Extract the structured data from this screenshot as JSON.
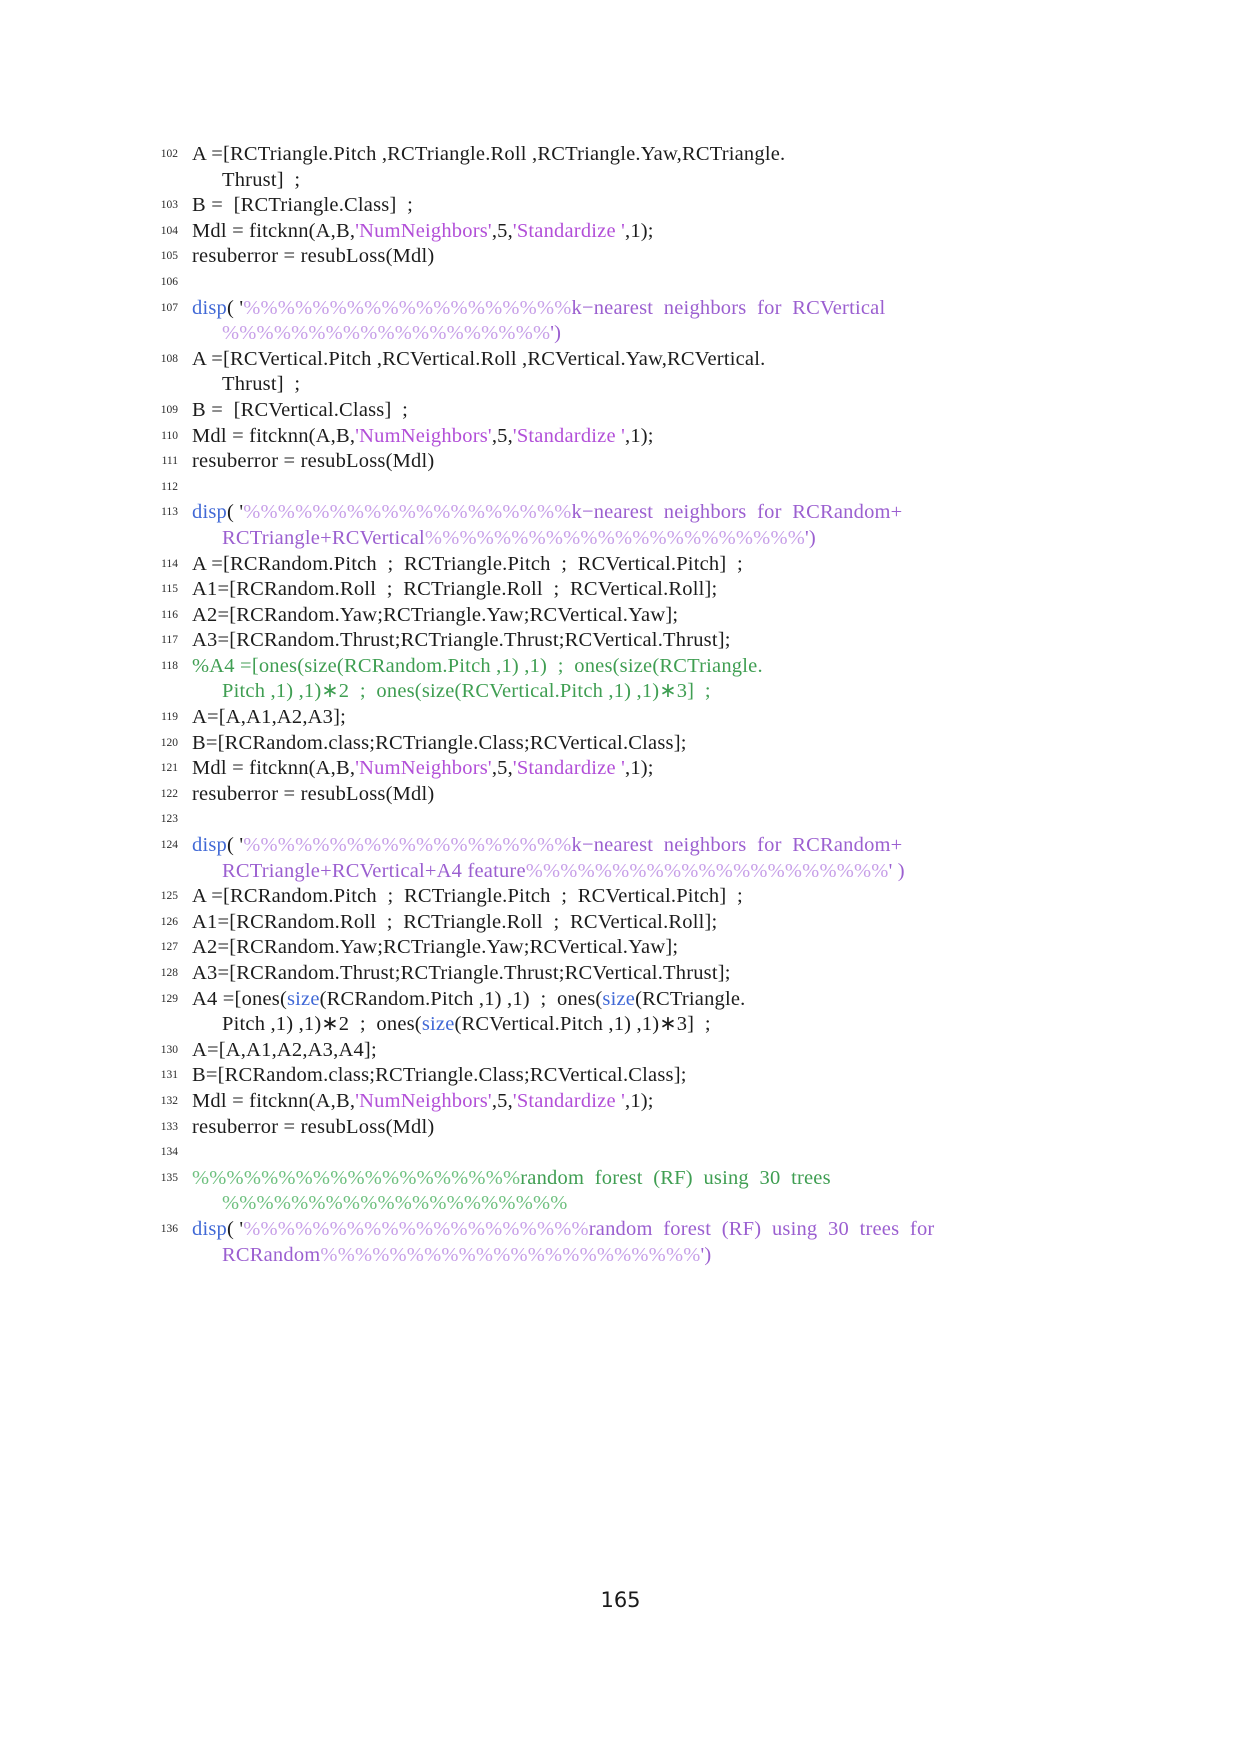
{
  "document": {
    "page_number": "165",
    "type": "code-listing",
    "language": "MATLAB"
  },
  "colors": {
    "plain": "#1c1c1c",
    "keyword": "#4169d6",
    "string": "#b24fd8",
    "string_text": "#9b5fd0",
    "percent_run": "#c79fe8",
    "comment": "#3f9e52",
    "comment_percent_run": "#6ec07f",
    "line_number": "#2b2b2b",
    "background": "#ffffff"
  },
  "listing": {
    "lines": [
      {
        "no": "102",
        "segments": [
          {
            "t": "A =[RCTriangle.Pitch ,RCTriangle.Roll ,RCTriangle.Yaw,RCTriangle.",
            "c": "plain"
          }
        ],
        "cont": [
          {
            "segments": [
              {
                "t": "Thrust]  ;",
                "c": "plain"
              }
            ]
          }
        ]
      },
      {
        "no": "103",
        "segments": [
          {
            "t": "B =  [RCTriangle.Class]  ;",
            "c": "plain"
          }
        ]
      },
      {
        "no": "104",
        "segments": [
          {
            "t": "Mdl = fitcknn(A,B,",
            "c": "plain"
          },
          {
            "t": "'NumNeighbors'",
            "c": "string"
          },
          {
            "t": ",5,",
            "c": "plain"
          },
          {
            "t": "'Standardize '",
            "c": "string"
          },
          {
            "t": ",1);",
            "c": "plain"
          }
        ]
      },
      {
        "no": "105",
        "segments": [
          {
            "t": "resuberror = resubLoss(Mdl)",
            "c": "plain"
          }
        ]
      },
      {
        "no": "106",
        "segments": []
      },
      {
        "no": "107",
        "segments": [
          {
            "t": "disp",
            "c": "keyword"
          },
          {
            "t": "( '",
            "c": "plain"
          },
          {
            "t": "%%%%%%%%%%%%%%%%%%%",
            "c": "percent_run"
          },
          {
            "t": "k−nearest  neighbors  for  RCVertical",
            "c": "string_text"
          }
        ],
        "cont": [
          {
            "segments": [
              {
                "t": "%%%%%%%%%%%%%%%%%%%",
                "c": "percent_run"
              },
              {
                "t": "')",
                "c": "string_text"
              }
            ]
          }
        ]
      },
      {
        "no": "108",
        "segments": [
          {
            "t": "A =[RCVertical.Pitch ,RCVertical.Roll ,RCVertical.Yaw,RCVertical.",
            "c": "plain"
          }
        ],
        "cont": [
          {
            "segments": [
              {
                "t": "Thrust]  ;",
                "c": "plain"
              }
            ]
          }
        ]
      },
      {
        "no": "109",
        "segments": [
          {
            "t": "B =  [RCVertical.Class]  ;",
            "c": "plain"
          }
        ]
      },
      {
        "no": "110",
        "segments": [
          {
            "t": "Mdl = fitcknn(A,B,",
            "c": "plain"
          },
          {
            "t": "'NumNeighbors'",
            "c": "string"
          },
          {
            "t": ",5,",
            "c": "plain"
          },
          {
            "t": "'Standardize '",
            "c": "string"
          },
          {
            "t": ",1);",
            "c": "plain"
          }
        ]
      },
      {
        "no": "111",
        "segments": [
          {
            "t": "resuberror = resubLoss(Mdl)",
            "c": "plain"
          }
        ]
      },
      {
        "no": "112",
        "segments": []
      },
      {
        "no": "113",
        "segments": [
          {
            "t": "disp",
            "c": "keyword"
          },
          {
            "t": "( '",
            "c": "plain"
          },
          {
            "t": "%%%%%%%%%%%%%%%%%%%",
            "c": "percent_run"
          },
          {
            "t": "k−nearest  neighbors  for  RCRandom+",
            "c": "string_text"
          }
        ],
        "cont": [
          {
            "segments": [
              {
                "t": "RCTriangle+RCVertical",
                "c": "string_text"
              },
              {
                "t": "%%%%%%%%%%%%%%%%%%%%%%",
                "c": "percent_run"
              },
              {
                "t": "')",
                "c": "string_text"
              }
            ]
          }
        ]
      },
      {
        "no": "114",
        "segments": [
          {
            "t": "A =[RCRandom.Pitch  ;  RCTriangle.Pitch  ;  RCVertical.Pitch]  ;",
            "c": "plain"
          }
        ]
      },
      {
        "no": "115",
        "segments": [
          {
            "t": "A1=[RCRandom.Roll  ;  RCTriangle.Roll  ;  RCVertical.Roll];",
            "c": "plain"
          }
        ]
      },
      {
        "no": "116",
        "segments": [
          {
            "t": "A2=[RCRandom.Yaw;RCTriangle.Yaw;RCVertical.Yaw];",
            "c": "plain"
          }
        ]
      },
      {
        "no": "117",
        "segments": [
          {
            "t": "A3=[RCRandom.Thrust;RCTriangle.Thrust;RCVertical.Thrust];",
            "c": "plain"
          }
        ]
      },
      {
        "no": "118",
        "segments": [
          {
            "t": "%A4 =[ones(size(RCRandom.Pitch ,1) ,1)  ;  ones(size(RCTriangle.",
            "c": "comment"
          }
        ],
        "cont": [
          {
            "segments": [
              {
                "t": "Pitch ,1) ,1)∗2  ;  ones(size(RCVertical.Pitch ,1) ,1)∗3]  ;",
                "c": "comment"
              }
            ]
          }
        ]
      },
      {
        "no": "119",
        "segments": [
          {
            "t": "A=[A,A1,A2,A3];",
            "c": "plain"
          }
        ]
      },
      {
        "no": "120",
        "segments": [
          {
            "t": "B=[RCRandom.class;RCTriangle.Class;RCVertical.Class];",
            "c": "plain"
          }
        ]
      },
      {
        "no": "121",
        "segments": [
          {
            "t": "Mdl = fitcknn(A,B,",
            "c": "plain"
          },
          {
            "t": "'NumNeighbors'",
            "c": "string"
          },
          {
            "t": ",5,",
            "c": "plain"
          },
          {
            "t": "'Standardize '",
            "c": "string"
          },
          {
            "t": ",1);",
            "c": "plain"
          }
        ]
      },
      {
        "no": "122",
        "segments": [
          {
            "t": "resuberror = resubLoss(Mdl)",
            "c": "plain"
          }
        ]
      },
      {
        "no": "123",
        "segments": []
      },
      {
        "no": "124",
        "segments": [
          {
            "t": "disp",
            "c": "keyword"
          },
          {
            "t": "( '",
            "c": "plain"
          },
          {
            "t": "%%%%%%%%%%%%%%%%%%%",
            "c": "percent_run"
          },
          {
            "t": "k−nearest  neighbors  for  RCRandom+",
            "c": "string_text"
          }
        ],
        "cont": [
          {
            "segments": [
              {
                "t": "RCTriangle+RCVertical+A4 feature",
                "c": "string_text"
              },
              {
                "t": "%%%%%%%%%%%%%%%%%%%%%",
                "c": "percent_run"
              },
              {
                "t": "' )",
                "c": "string_text"
              }
            ]
          }
        ]
      },
      {
        "no": "125",
        "segments": [
          {
            "t": "A =[RCRandom.Pitch  ;  RCTriangle.Pitch  ;  RCVertical.Pitch]  ;",
            "c": "plain"
          }
        ]
      },
      {
        "no": "126",
        "segments": [
          {
            "t": "A1=[RCRandom.Roll  ;  RCTriangle.Roll  ;  RCVertical.Roll];",
            "c": "plain"
          }
        ]
      },
      {
        "no": "127",
        "segments": [
          {
            "t": "A2=[RCRandom.Yaw;RCTriangle.Yaw;RCVertical.Yaw];",
            "c": "plain"
          }
        ]
      },
      {
        "no": "128",
        "segments": [
          {
            "t": "A3=[RCRandom.Thrust;RCTriangle.Thrust;RCVertical.Thrust];",
            "c": "plain"
          }
        ]
      },
      {
        "no": "129",
        "segments": [
          {
            "t": "A4 =[ones(",
            "c": "plain"
          },
          {
            "t": "size",
            "c": "keyword"
          },
          {
            "t": "(RCRandom.Pitch ,1) ,1)  ;  ones(",
            "c": "plain"
          },
          {
            "t": "size",
            "c": "keyword"
          },
          {
            "t": "(RCTriangle.",
            "c": "plain"
          }
        ],
        "cont": [
          {
            "segments": [
              {
                "t": "Pitch ,1) ,1)∗2  ;  ones(",
                "c": "plain"
              },
              {
                "t": "size",
                "c": "keyword"
              },
              {
                "t": "(RCVertical.Pitch ,1) ,1)∗3]  ;",
                "c": "plain"
              }
            ]
          }
        ]
      },
      {
        "no": "130",
        "segments": [
          {
            "t": "A=[A,A1,A2,A3,A4];",
            "c": "plain"
          }
        ]
      },
      {
        "no": "131",
        "segments": [
          {
            "t": "B=[RCRandom.class;RCTriangle.Class;RCVertical.Class];",
            "c": "plain"
          }
        ]
      },
      {
        "no": "132",
        "segments": [
          {
            "t": "Mdl = fitcknn(A,B,",
            "c": "plain"
          },
          {
            "t": "'NumNeighbors'",
            "c": "string"
          },
          {
            "t": ",5,",
            "c": "plain"
          },
          {
            "t": "'Standardize '",
            "c": "string"
          },
          {
            "t": ",1);",
            "c": "plain"
          }
        ]
      },
      {
        "no": "133",
        "segments": [
          {
            "t": "resuberror = resubLoss(Mdl)",
            "c": "plain"
          }
        ]
      },
      {
        "no": "134",
        "segments": []
      },
      {
        "no": "135",
        "segments": [
          {
            "t": "%%%%%%%%%%%%%%%%%%%",
            "c": "comment_percent_run"
          },
          {
            "t": "random  forest  (RF)  using  30  trees",
            "c": "comment"
          }
        ],
        "cont": [
          {
            "segments": [
              {
                "t": "%%%%%%%%%%%%%%%%%%%%",
                "c": "comment_percent_run"
              }
            ]
          }
        ]
      },
      {
        "no": "136",
        "segments": [
          {
            "t": "disp",
            "c": "keyword"
          },
          {
            "t": "( '",
            "c": "plain"
          },
          {
            "t": "%%%%%%%%%%%%%%%%%%%%",
            "c": "percent_run"
          },
          {
            "t": "random  forest  (RF)  using  30  trees  for",
            "c": "string_text"
          }
        ],
        "cont": [
          {
            "segments": [
              {
                "t": "RCRandom",
                "c": "string_text"
              },
              {
                "t": "%%%%%%%%%%%%%%%%%%%%%%",
                "c": "percent_run"
              },
              {
                "t": "')",
                "c": "string_text"
              }
            ]
          }
        ]
      }
    ]
  }
}
